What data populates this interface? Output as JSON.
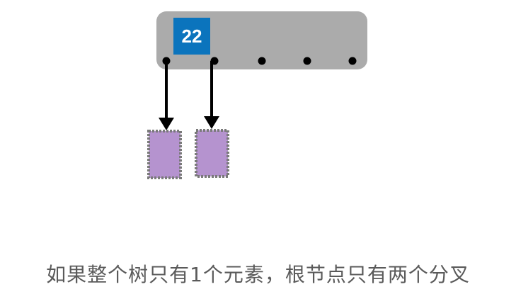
{
  "root_node": {
    "keys": [
      "22"
    ],
    "pointer_count": 5,
    "node_color": "#ababab",
    "key_color": "#0b74bd"
  },
  "children": {
    "count": 2,
    "color": "#b593cf",
    "border_color": "#7a7a7a",
    "border_style": "dotted"
  },
  "arrow_color": "#000000",
  "caption": "如果整个树只有1个元素，根节点只有两个分叉"
}
